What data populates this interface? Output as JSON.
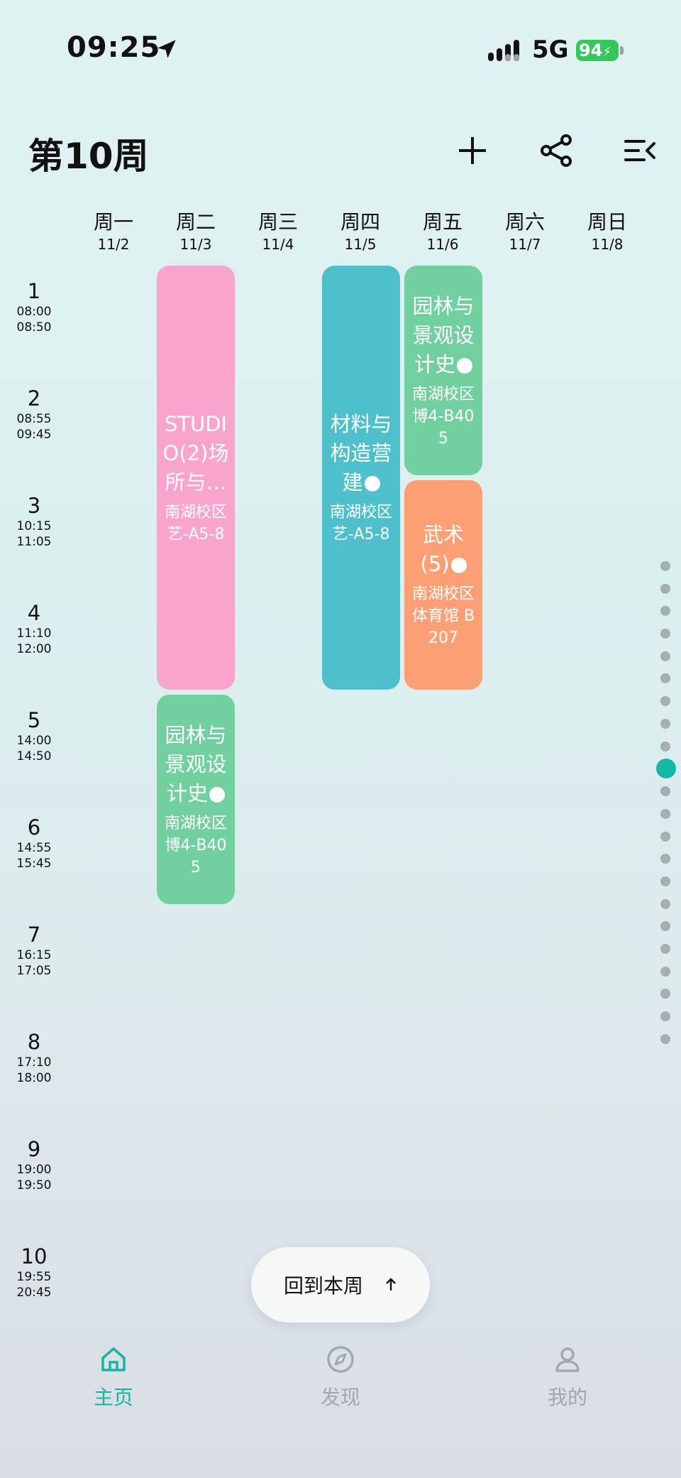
{
  "status_bar": {
    "time": "09:25",
    "network": "5G",
    "battery": "94"
  },
  "header": {
    "title": "第10周",
    "add_icon": "plus-icon",
    "share_icon": "share-icon",
    "menu_icon": "menu-collapse-icon"
  },
  "days": [
    {
      "name": "周一",
      "date": "11/2"
    },
    {
      "name": "周二",
      "date": "11/3"
    },
    {
      "name": "周三",
      "date": "11/4"
    },
    {
      "name": "周四",
      "date": "11/5"
    },
    {
      "name": "周五",
      "date": "11/6"
    },
    {
      "name": "周六",
      "date": "11/7"
    },
    {
      "name": "周日",
      "date": "11/8"
    }
  ],
  "periods": [
    {
      "num": "1",
      "start": "08:00",
      "end": "08:50"
    },
    {
      "num": "2",
      "start": "08:55",
      "end": "09:45"
    },
    {
      "num": "3",
      "start": "10:15",
      "end": "11:05"
    },
    {
      "num": "4",
      "start": "11:10",
      "end": "12:00"
    },
    {
      "num": "5",
      "start": "14:00",
      "end": "14:50"
    },
    {
      "num": "6",
      "start": "14:55",
      "end": "15:45"
    },
    {
      "num": "7",
      "start": "16:15",
      "end": "17:05"
    },
    {
      "num": "8",
      "start": "17:10",
      "end": "18:00"
    },
    {
      "num": "9",
      "start": "19:00",
      "end": "19:50"
    },
    {
      "num": "10",
      "start": "19:55",
      "end": "20:45"
    }
  ],
  "courses": [
    {
      "name": "STUDIO(2)场所与…",
      "room": "南湖校区 艺-A5-8",
      "day": "周二",
      "periods": "1-4",
      "color": "#f9a4cc"
    },
    {
      "name": "园林与景观设计史",
      "room": "南湖校区 博4-B405",
      "day": "周二",
      "periods": "5-6",
      "color": "#72cf9f"
    },
    {
      "name": "材料与构造营建",
      "room": "南湖校区 艺-A5-8",
      "day": "周四",
      "periods": "1-4",
      "color": "#4ec0cc"
    },
    {
      "name": "园林与景观设计史",
      "room": "南湖校区 博4-B405",
      "day": "周五",
      "periods": "1-2",
      "color": "#72cf9f"
    },
    {
      "name": "武术(5)",
      "room": "南湖校区 体育馆 B207",
      "day": "周五",
      "periods": "3-4",
      "color": "#fd9f75"
    }
  ],
  "week_selector": {
    "total_weeks": 22,
    "current_week": 10
  },
  "back_button": {
    "label": "回到本周",
    "icon": "arrow-up-icon"
  },
  "tabbar": [
    {
      "label": "主页",
      "icon": "home-icon",
      "active": true
    },
    {
      "label": "发现",
      "icon": "compass-icon",
      "active": false
    },
    {
      "label": "我的",
      "icon": "person-icon",
      "active": false
    }
  ],
  "colors": {
    "accent": "#16b4a3",
    "pink": "#f9a4cc",
    "teal": "#4ec0cc",
    "green": "#72cf9f",
    "orange": "#fd9f75"
  }
}
